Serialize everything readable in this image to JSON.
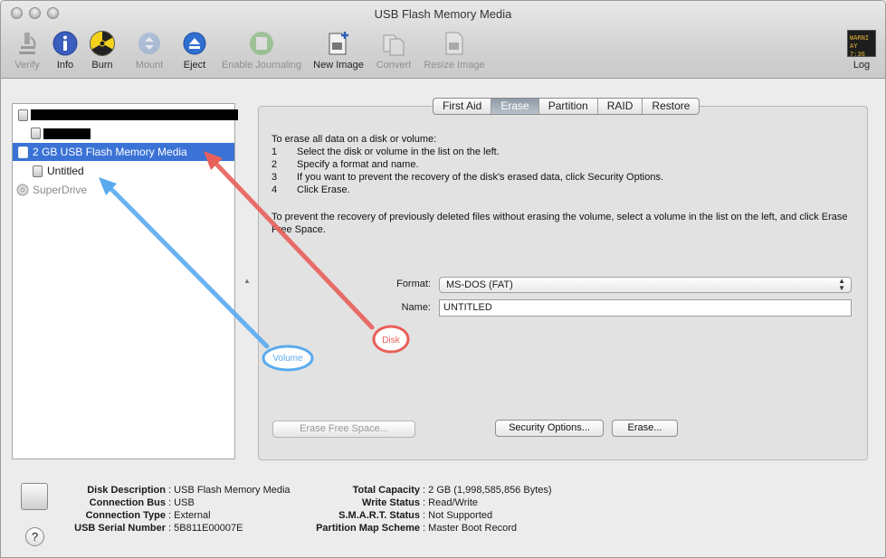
{
  "window": {
    "title": "USB Flash Memory Media"
  },
  "toolbar": [
    {
      "id": "verify",
      "label": "Verify",
      "icon": "microscope-icon",
      "enabled": false
    },
    {
      "id": "info",
      "label": "Info",
      "icon": "info-icon",
      "enabled": true
    },
    {
      "id": "burn",
      "label": "Burn",
      "icon": "radiation-icon",
      "enabled": true
    },
    {
      "id": "mount",
      "label": "Mount",
      "icon": "mount-icon",
      "enabled": false
    },
    {
      "id": "eject",
      "label": "Eject",
      "icon": "eject-icon",
      "enabled": true
    },
    {
      "id": "journaling",
      "label": "Enable Journaling",
      "icon": "journal-icon",
      "enabled": false
    },
    {
      "id": "new-image",
      "label": "New Image",
      "icon": "new-image-icon",
      "enabled": true
    },
    {
      "id": "convert",
      "label": "Convert",
      "icon": "convert-icon",
      "enabled": false
    },
    {
      "id": "resize-image",
      "label": "Resize Image",
      "icon": "resize-image-icon",
      "enabled": false
    },
    {
      "id": "log",
      "label": "Log",
      "icon": "log-icon",
      "enabled": true,
      "badge": [
        "WARNI",
        "AY 7:36"
      ]
    }
  ],
  "sidebar": {
    "items": [
      {
        "label": "",
        "type": "disk",
        "redacted": true
      },
      {
        "label": "",
        "type": "volume",
        "redacted": true
      },
      {
        "label": "2 GB USB Flash Memory Media",
        "type": "disk",
        "selected": true
      },
      {
        "label": "Untitled",
        "type": "volume"
      },
      {
        "label": "SuperDrive",
        "type": "optical",
        "dimmed": true
      }
    ]
  },
  "tabs": [
    {
      "label": "First Aid",
      "active": false
    },
    {
      "label": "Erase",
      "active": true
    },
    {
      "label": "Partition",
      "active": false
    },
    {
      "label": "RAID",
      "active": false
    },
    {
      "label": "Restore",
      "active": false
    }
  ],
  "erase": {
    "intro": "To erase all data on a disk or volume:",
    "steps": [
      {
        "n": "1",
        "text": "Select the disk or volume in the list on the left."
      },
      {
        "n": "2",
        "text": "Specify a format and name."
      },
      {
        "n": "3",
        "text": "If you want to prevent the recovery of the disk's erased data, click Security Options."
      },
      {
        "n": "4",
        "text": "Click Erase."
      }
    ],
    "prevent_text": "To prevent the recovery of previously deleted files without erasing the volume, select a volume in the list on the left, and click Erase Free Space.",
    "format_label": "Format:",
    "format_value": "MS-DOS (FAT)",
    "name_label": "Name:",
    "name_value": "UNTITLED",
    "erase_free_space": "Erase Free Space...",
    "security_options": "Security Options...",
    "erase_button": "Erase..."
  },
  "annotations": {
    "disk": "Disk",
    "volume": "Volume",
    "disk_color": "#e8605a",
    "volume_color": "#5aaaf0"
  },
  "details": {
    "left": [
      {
        "k": "Disk Description",
        "v": "USB Flash Memory Media"
      },
      {
        "k": "Connection Bus",
        "v": "USB"
      },
      {
        "k": "Connection Type",
        "v": "External"
      },
      {
        "k": "USB Serial Number",
        "v": "5B811E00007E"
      }
    ],
    "right": [
      {
        "k": "Total Capacity",
        "v": "2 GB (1,998,585,856 Bytes)"
      },
      {
        "k": "Write Status",
        "v": "Read/Write"
      },
      {
        "k": "S.M.A.R.T. Status",
        "v": "Not Supported"
      },
      {
        "k": "Partition Map Scheme",
        "v": "Master Boot Record"
      }
    ]
  },
  "help_label": "?"
}
